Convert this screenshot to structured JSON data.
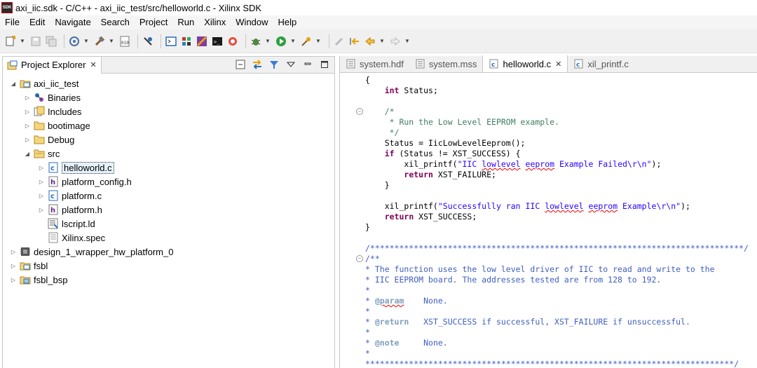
{
  "window": {
    "title": "axi_iic.sdk - C/C++ - axi_iic_test/src/helloworld.c - Xilinx SDK",
    "app_icon_text": "SDK"
  },
  "menu": [
    "File",
    "Edit",
    "Navigate",
    "Search",
    "Project",
    "Run",
    "Xilinx",
    "Window",
    "Help"
  ],
  "toolbar": {
    "icons": [
      "new-icon",
      "save-icon",
      "save-all-icon",
      "target-icon",
      "build-icon",
      "binary-icon",
      "debug-icon",
      "terminal-icon",
      "program-fpga-icon",
      "blocks-icon",
      "sdk-terminal-icon",
      "repository-icon",
      "bug-icon",
      "run-icon",
      "external-tools-icon",
      "edit-icon",
      "last-edit-icon",
      "back-icon",
      "forward-icon"
    ]
  },
  "explorer": {
    "tab_label": "Project Explorer",
    "tab_close": "✕",
    "tree": [
      {
        "label": "axi_iic_test",
        "level": 0,
        "expanded": true,
        "icon": "project-folder-icon"
      },
      {
        "label": "Binaries",
        "level": 1,
        "expanded": false,
        "icon": "binaries-icon"
      },
      {
        "label": "Includes",
        "level": 1,
        "expanded": false,
        "icon": "includes-icon"
      },
      {
        "label": "bootimage",
        "level": 1,
        "expanded": false,
        "icon": "folder-icon"
      },
      {
        "label": "Debug",
        "level": 1,
        "expanded": false,
        "icon": "folder-icon"
      },
      {
        "label": "src",
        "level": 1,
        "expanded": true,
        "icon": "source-folder-icon"
      },
      {
        "label": "helloworld.c",
        "level": 2,
        "expanded": false,
        "icon": "c-file-icon",
        "selected": true
      },
      {
        "label": "platform_config.h",
        "level": 2,
        "expanded": false,
        "icon": "h-file-icon"
      },
      {
        "label": "platform.c",
        "level": 2,
        "expanded": false,
        "icon": "c-file-icon"
      },
      {
        "label": "platform.h",
        "level": 2,
        "expanded": false,
        "icon": "h-file-icon"
      },
      {
        "label": "lscript.ld",
        "level": 2,
        "leaf": true,
        "icon": "linker-script-icon"
      },
      {
        "label": "Xilinx.spec",
        "level": 2,
        "leaf": true,
        "icon": "spec-file-icon"
      },
      {
        "label": "design_1_wrapper_hw_platform_0",
        "level": 0,
        "expanded": false,
        "icon": "hw-platform-icon"
      },
      {
        "label": "fsbl",
        "level": 0,
        "expanded": false,
        "icon": "project-folder-icon"
      },
      {
        "label": "fsbl_bsp",
        "level": 0,
        "expanded": false,
        "icon": "bsp-icon"
      }
    ]
  },
  "editor": {
    "tabs": [
      {
        "label": "system.hdf",
        "active": false,
        "icon": "hdf-file-icon"
      },
      {
        "label": "system.mss",
        "active": false,
        "icon": "mss-file-icon"
      },
      {
        "label": "helloworld.c",
        "active": true,
        "icon": "c-file-icon",
        "close": "✕"
      },
      {
        "label": "xil_printf.c",
        "active": false,
        "icon": "c-file-icon"
      }
    ],
    "code": [
      "{",
      "    int Status;",
      "",
      "    /*",
      "     * Run the Low Level EEPROM example.",
      "     */",
      "    Status = IicLowLevelEeprom();",
      "    if (Status != XST_SUCCESS) {",
      "        xil_printf(\"IIC lowlevel eeprom Example Failed\\r\\n\");",
      "        return XST_FAILURE;",
      "    }",
      "",
      "    xil_printf(\"Successfully ran IIC lowlevel eeprom Example\\r\\n\");",
      "    return XST_SUCCESS;",
      "}",
      "",
      "/*****************************************************************************/",
      "/**",
      "* The function uses the low level driver of IIC to read and write to the",
      "* IIC EEPROM board. The addresses tested are from 128 to 192.",
      "*",
      "* @param    None.",
      "*",
      "* @return   XST_SUCCESS if successful, XST_FAILURE if unsuccessful.",
      "*",
      "* @note     None.",
      "*",
      "****************************************************************************/"
    ]
  }
}
